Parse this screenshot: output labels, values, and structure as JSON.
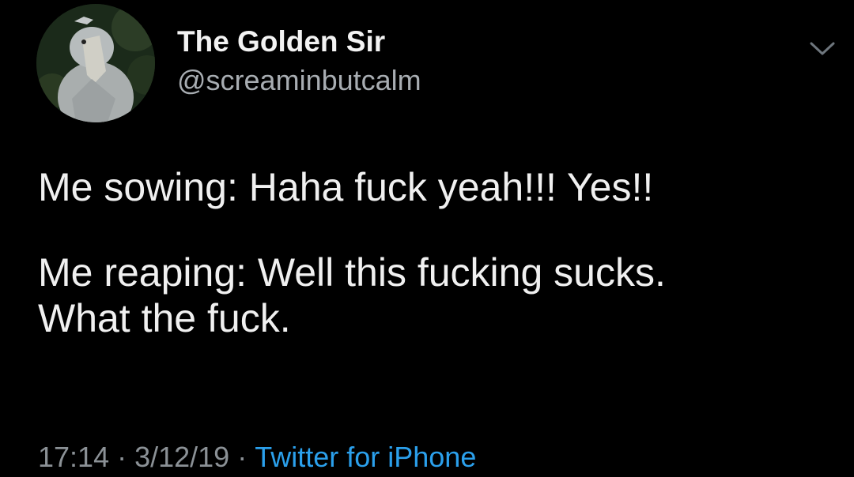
{
  "tweet": {
    "author": {
      "display_name": "The Golden Sir",
      "handle": "@screaminbutcalm",
      "avatar_icon": "shoebill-bird-avatar"
    },
    "menu_icon": "chevron-down-icon",
    "lines": [
      "Me sowing: Haha fuck yeah!!! Yes!!",
      "Me reaping: Well this fucking sucks.",
      "What the fuck."
    ],
    "meta": {
      "time": "17:14",
      "separator": "·",
      "date": "3/12/19",
      "source": "Twitter for iPhone"
    }
  },
  "colors": {
    "background": "#000000",
    "text": "#f0f0f0",
    "muted": "#8b9196",
    "link": "#2ba0ec"
  }
}
